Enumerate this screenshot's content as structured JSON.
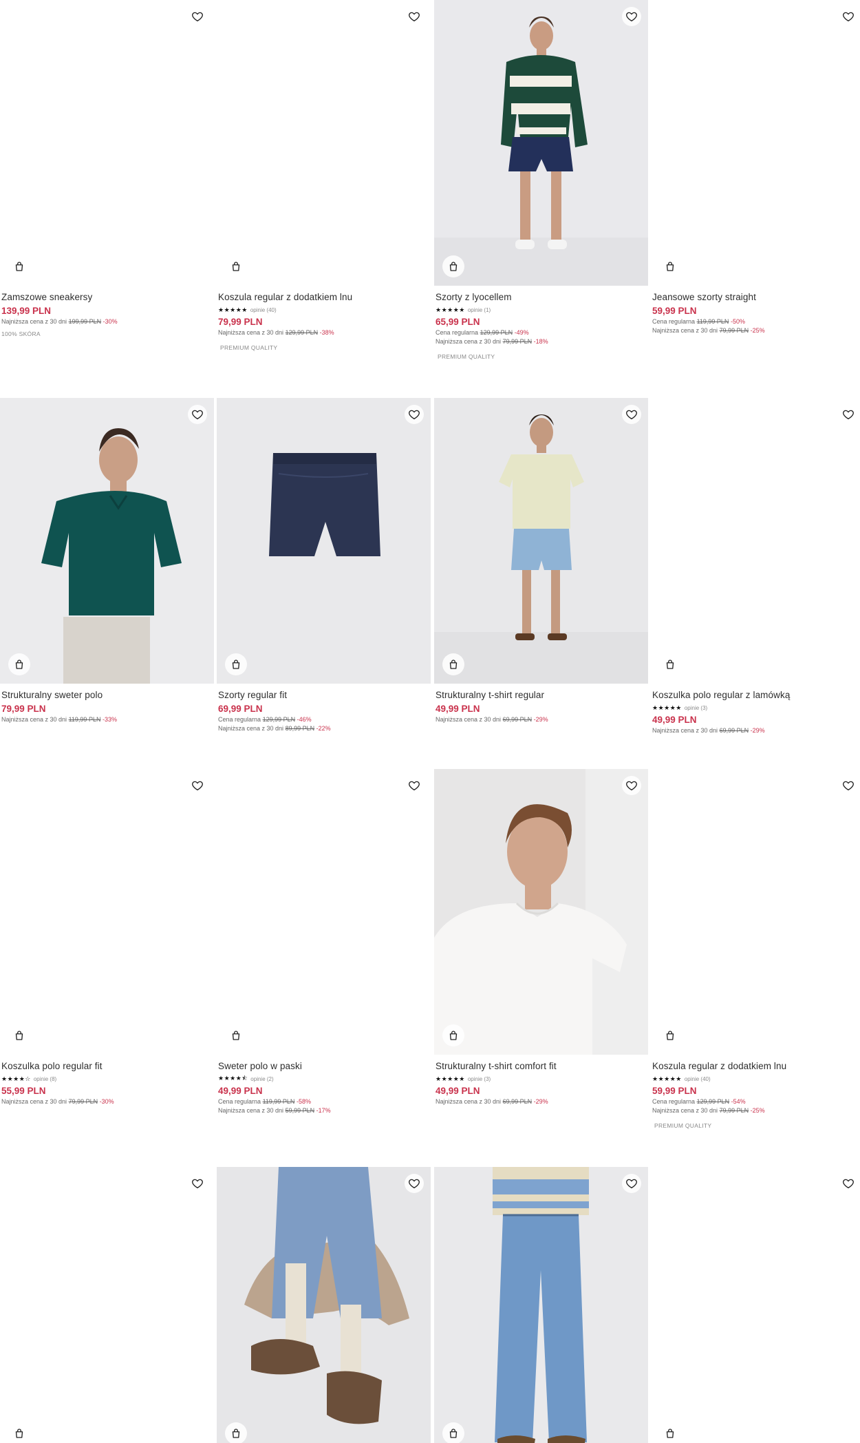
{
  "colors": {
    "price": "#c9324c",
    "text": "#2d2d2d",
    "muted": "#666666",
    "photo_bg": "#ececee"
  },
  "icons": {
    "wishlist": "heart-icon",
    "add_to_cart": "shopping-bag-icon"
  },
  "products": [
    {
      "name": "Zamszowe sneakersy",
      "price": "139,99 PLN",
      "hist": [
        {
          "label": "Najniższa cena z 30 dni",
          "old": "199,99 PLN",
          "disc": "-30%"
        }
      ],
      "tag": "100% SKÓRA"
    },
    {
      "name": "Koszula regular z dodatkiem lnu",
      "stars": "★★★★★",
      "reviews": "opinie (40)",
      "price": "79,99 PLN",
      "hist": [
        {
          "label": "Najniższa cena z 30 dni",
          "old": "129,99 PLN",
          "disc": "-38%"
        }
      ],
      "tag": "PREMIUM QUALITY"
    },
    {
      "name": "Szorty z lyocellem",
      "stars": "★★★★★",
      "reviews": "opinie (1)",
      "price": "65,99 PLN",
      "hist": [
        {
          "label": "Cena regularna",
          "old": "129,99 PLN",
          "disc": "-49%"
        },
        {
          "label": "Najniższa cena z 30 dni",
          "old": "79,99 PLN",
          "disc": "-18%"
        }
      ],
      "tag": "PREMIUM QUALITY"
    },
    {
      "name": "Jeansowe szorty straight",
      "price": "59,99 PLN",
      "hist": [
        {
          "label": "Cena regularna",
          "old": "119,99 PLN",
          "disc": "-50%"
        },
        {
          "label": "Najniższa cena z 30 dni",
          "old": "79,99 PLN",
          "disc": "-25%"
        }
      ]
    },
    {
      "name": "Strukturalny sweter polo",
      "price": "79,99 PLN",
      "hist": [
        {
          "label": "Najniższa cena z 30 dni",
          "old": "119,99 PLN",
          "disc": "-33%"
        }
      ]
    },
    {
      "name": "Szorty regular fit",
      "price": "69,99 PLN",
      "hist": [
        {
          "label": "Cena regularna",
          "old": "129,99 PLN",
          "disc": "-46%"
        },
        {
          "label": "Najniższa cena z 30 dni",
          "old": "89,99 PLN",
          "disc": "-22%"
        }
      ]
    },
    {
      "name": "Strukturalny t-shirt regular",
      "price": "49,99 PLN",
      "hist": [
        {
          "label": "Najniższa cena z 30 dni",
          "old": "69,99 PLN",
          "disc": "-29%"
        }
      ]
    },
    {
      "name": "Koszulka polo regular z lamówką",
      "stars": "★★★★★",
      "reviews": "opinie (3)",
      "price": "49,99 PLN",
      "hist": [
        {
          "label": "Najniższa cena z 30 dni",
          "old": "69,99 PLN",
          "disc": "-29%"
        }
      ]
    },
    {
      "name": "Koszulka polo regular fit",
      "stars": "★★★★☆",
      "reviews": "opinie (8)",
      "price": "55,99 PLN",
      "hist": [
        {
          "label": "Najniższa cena z 30 dni",
          "old": "79,99 PLN",
          "disc": "-30%"
        }
      ]
    },
    {
      "name": "Sweter polo w paski",
      "stars": "★★★★⯪",
      "reviews": "opinie (2)",
      "price": "49,99 PLN",
      "hist": [
        {
          "label": "Cena regularna",
          "old": "119,99 PLN",
          "disc": "-58%"
        },
        {
          "label": "Najniższa cena z 30 dni",
          "old": "59,99 PLN",
          "disc": "-17%"
        }
      ]
    },
    {
      "name": "Strukturalny t-shirt comfort fit",
      "stars": "★★★★★",
      "reviews": "opinie (3)",
      "price": "49,99 PLN",
      "hist": [
        {
          "label": "Najniższa cena z 30 dni",
          "old": "69,99 PLN",
          "disc": "-29%"
        }
      ]
    },
    {
      "name": "Koszula regular z dodatkiem lnu",
      "stars": "★★★★★",
      "reviews": "opinie (40)",
      "price": "59,99 PLN",
      "hist": [
        {
          "label": "Cena regularna",
          "old": "129,99 PLN",
          "disc": "-54%"
        },
        {
          "label": "Najniższa cena z 30 dni",
          "old": "79,99 PLN",
          "disc": "-25%"
        }
      ],
      "tag": "PREMIUM QUALITY"
    }
  ]
}
